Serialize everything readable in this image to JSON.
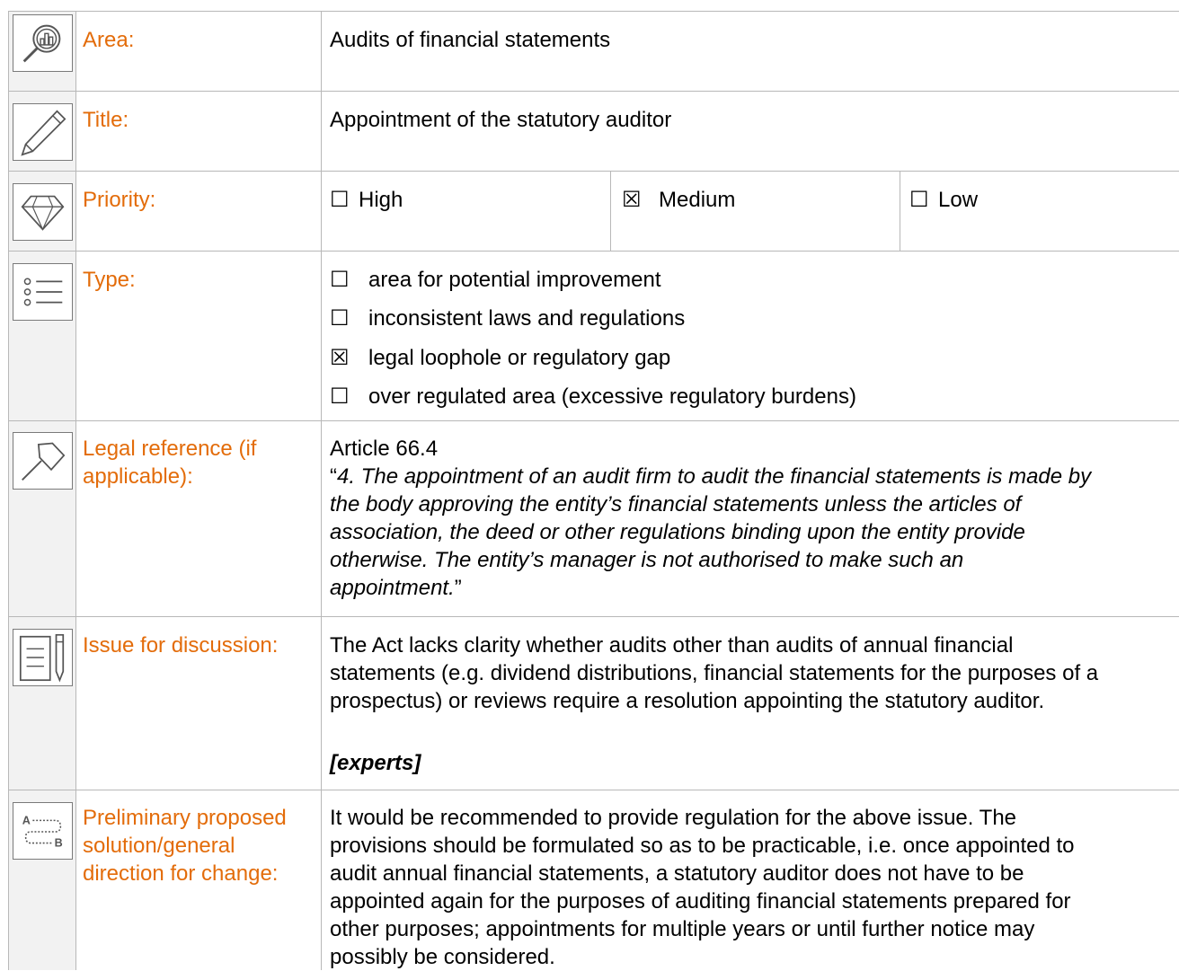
{
  "rows": {
    "area": {
      "label": "Area:",
      "icon": "audit-magnifier-chart-icon",
      "value": "Audits of financial statements"
    },
    "title": {
      "label": "Title:",
      "icon": "pencil-icon",
      "value": "Appointment of the statutory auditor"
    },
    "priority": {
      "label": "Priority:",
      "icon": "diamond-icon",
      "options": [
        {
          "box": "☐",
          "label": "High",
          "checked": false
        },
        {
          "box": "☒",
          "label": "Medium",
          "checked": true
        },
        {
          "box": "☐",
          "label": "Low",
          "checked": false
        }
      ]
    },
    "type": {
      "label": "Type:",
      "icon": "list-icon",
      "options": [
        {
          "box": "☐",
          "label": "area for potential improvement",
          "checked": false
        },
        {
          "box": "☐",
          "label": "inconsistent laws and regulations",
          "checked": false
        },
        {
          "box": "☒",
          "label": "legal loophole or regulatory gap",
          "checked": true
        },
        {
          "box": "☐",
          "label": "over regulated area (excessive regulatory burdens)",
          "checked": false
        }
      ]
    },
    "legal": {
      "label_line1": "Legal reference (if",
      "label_line2": "applicable):",
      "icon": "gavel-icon",
      "article": "Article 66.4",
      "quote_open": "“",
      "quote_lines": [
        "4. The appointment of an audit firm to audit the financial statements is made by",
        "the body approving the entity’s financial statements unless the articles of",
        "association, the deed or other regulations binding upon the entity provide",
        "otherwise. The entity’s manager is not authorised to make such an",
        "appointment."
      ],
      "quote_close": "”"
    },
    "issue": {
      "label": "Issue for discussion:",
      "icon": "document-pen-icon",
      "lines": [
        "The Act lacks clarity whether audits other than audits of annual financial",
        "statements (e.g. dividend distributions, financial statements for the purposes of a",
        "prospectus) or reviews require a resolution appointing the statutory auditor."
      ],
      "experts": "[experts]"
    },
    "solution": {
      "label_lines": [
        "Preliminary proposed",
        "solution/general",
        "direction for change:"
      ],
      "icon": "path-a-to-b-icon",
      "icon_a": "A",
      "icon_b": "B",
      "lines": [
        "It would be recommended to provide regulation for the above issue. The",
        "provisions should be formulated so as to be practicable, i.e. once appointed to",
        "audit annual financial statements, a statutory auditor does not have to be",
        "appointed again for the purposes of auditing financial statements prepared for",
        "other purposes; appointments for multiple years or until further notice may",
        "possibly be considered."
      ]
    }
  },
  "colors": {
    "label": "#e36c0a",
    "grid": "#b8b8b8",
    "icon_bg": "#f2f2f2"
  }
}
